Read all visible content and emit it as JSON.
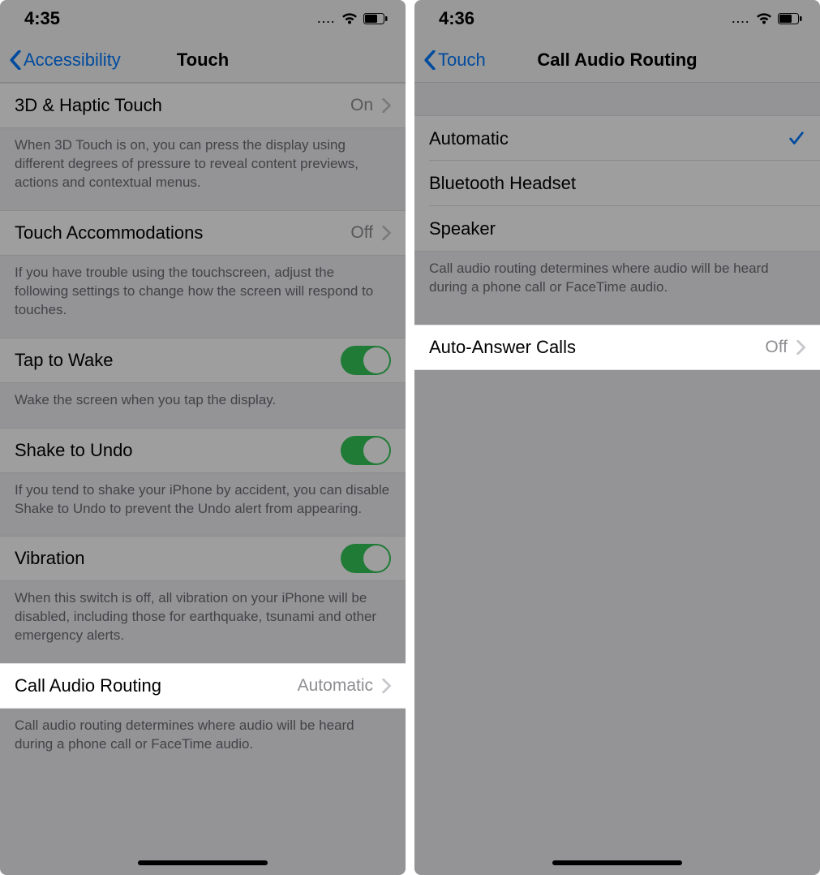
{
  "left": {
    "status": {
      "time": "4:35"
    },
    "nav": {
      "back": "Accessibility",
      "title": "Touch"
    },
    "row_3d": {
      "label": "3D & Haptic Touch",
      "value": "On"
    },
    "footer_3d": "When 3D Touch is on, you can press the display using different degrees of pressure to reveal content previews, actions and contextual menus.",
    "row_ta": {
      "label": "Touch Accommodations",
      "value": "Off"
    },
    "footer_ta": "If you have trouble using the touchscreen, adjust the following settings to change how the screen will respond to touches.",
    "row_ttw": {
      "label": "Tap to Wake"
    },
    "footer_ttw": "Wake the screen when you tap the display.",
    "row_stu": {
      "label": "Shake to Undo"
    },
    "footer_stu": "If you tend to shake your iPhone by accident, you can disable Shake to Undo to prevent the Undo alert from appearing.",
    "row_vib": {
      "label": "Vibration"
    },
    "footer_vib": "When this switch is off, all vibration on your iPhone will be disabled, including those for earthquake, tsunami and other emergency alerts.",
    "row_car": {
      "label": "Call Audio Routing",
      "value": "Automatic"
    },
    "footer_car": "Call audio routing determines where audio will be heard during a phone call or FaceTime audio."
  },
  "right": {
    "status": {
      "time": "4:36"
    },
    "nav": {
      "back": "Touch",
      "title": "Call Audio Routing"
    },
    "opt_auto": "Automatic",
    "opt_bt": "Bluetooth Headset",
    "opt_spk": "Speaker",
    "footer_opts": "Call audio routing determines where audio will be heard during a phone call or FaceTime audio.",
    "row_aa": {
      "label": "Auto-Answer Calls",
      "value": "Off"
    }
  }
}
